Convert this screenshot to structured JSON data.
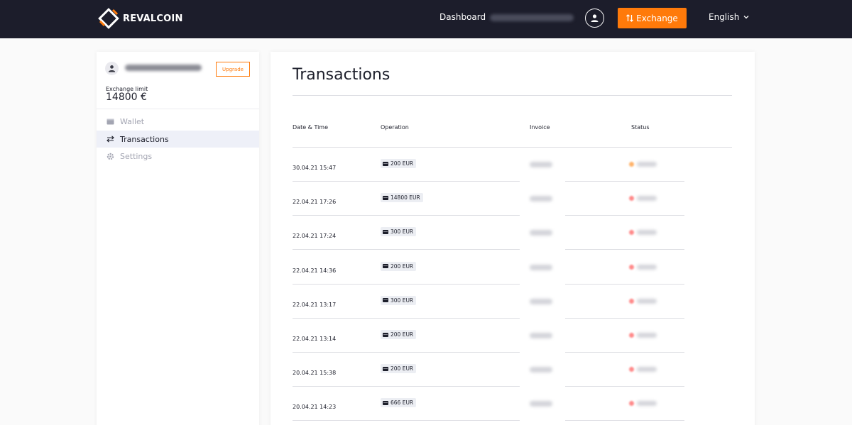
{
  "header": {
    "brand": "REVALCOIN",
    "nav_dashboard": "Dashboard",
    "exchange_label": "Exchange",
    "language": "English",
    "colors": {
      "bar": "#1c1d2b",
      "accent": "#ff7a0a"
    }
  },
  "sidebar": {
    "upgrade_label": "Upgrade",
    "limit_label": "Exchange limit",
    "limit_value": "14800 €",
    "items": [
      {
        "label": "Wallet",
        "icon": "wallet-icon"
      },
      {
        "label": "Transactions",
        "icon": "transfer-arrows-icon",
        "active": true
      },
      {
        "label": "Settings",
        "icon": "gear-icon"
      }
    ]
  },
  "main": {
    "title": "Transactions",
    "columns": [
      "Date & Time",
      "Operation",
      "Invoice",
      "Status"
    ],
    "rows": [
      {
        "date": "30.04.21 15:47",
        "operation": "200 EUR",
        "status_color": "#ffb36b"
      },
      {
        "date": "22.04.21 17:26",
        "operation": "14800 EUR",
        "status_color": "#ff8a8a"
      },
      {
        "date": "22.04.21 17:24",
        "operation": "300 EUR",
        "status_color": "#ff8a8a"
      },
      {
        "date": "22.04.21 14:36",
        "operation": "200 EUR",
        "status_color": "#ff8a8a"
      },
      {
        "date": "22.04.21 13:17",
        "operation": "300 EUR",
        "status_color": "#ff8a8a"
      },
      {
        "date": "22.04.21 13:14",
        "operation": "200 EUR",
        "status_color": "#ff8a8a"
      },
      {
        "date": "20.04.21 15:38",
        "operation": "200 EUR",
        "status_color": "#ff8a8a"
      },
      {
        "date": "20.04.21 14:23",
        "operation": "666 EUR",
        "status_color": "#ff8a8a"
      }
    ]
  }
}
